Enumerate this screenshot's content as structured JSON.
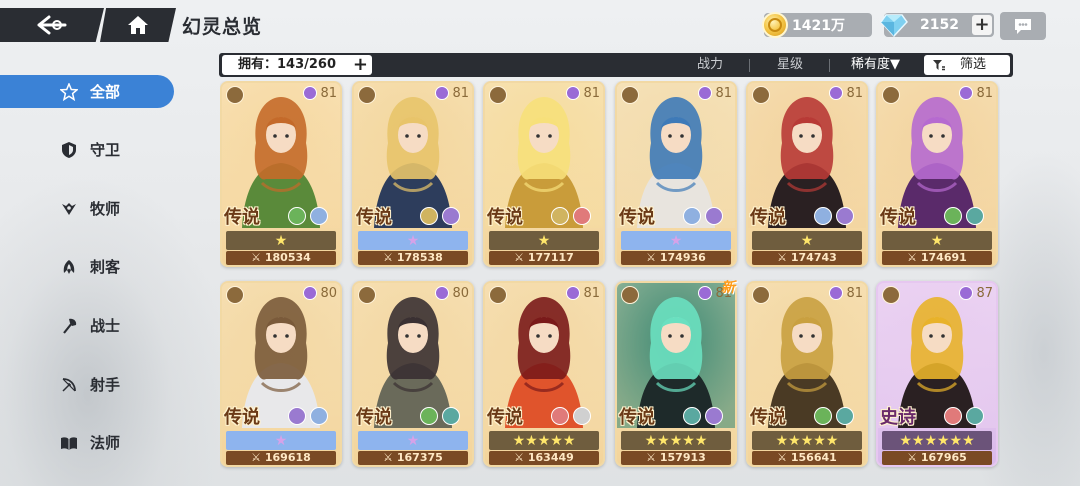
{
  "header": {
    "title": "幻灵总览",
    "gold": "1421万",
    "gems": "2152"
  },
  "filterbar": {
    "owned_label": "拥有：143/260",
    "sort_power": "战力",
    "sort_star": "星级",
    "sort_rarity": "稀有度▼",
    "filter_label": "筛选"
  },
  "sidebar": {
    "items": [
      {
        "label": "全部",
        "icon": "star-outline-icon",
        "active": true
      },
      {
        "label": "守卫",
        "icon": "shield-icon",
        "active": false
      },
      {
        "label": "牧师",
        "icon": "wings-icon",
        "active": false
      },
      {
        "label": "刺客",
        "icon": "dagger-icon",
        "active": false
      },
      {
        "label": "战士",
        "icon": "axe-icon",
        "active": false
      },
      {
        "label": "射手",
        "icon": "bow-icon",
        "active": false
      },
      {
        "label": "法师",
        "icon": "book-icon",
        "active": false
      }
    ]
  },
  "cards": [
    {
      "rarity": "传说",
      "level": "81",
      "power": "180534",
      "band": "dark",
      "stars": "★",
      "palette": [
        "#f6d9a3",
        "#5a8a3a",
        "#c46a2a"
      ],
      "elements": [
        "#6bb35a",
        "#8fb0e0"
      ],
      "role": "book-icon"
    },
    {
      "rarity": "传说",
      "level": "81",
      "power": "178538",
      "band": "blue",
      "stars": "★",
      "palette": [
        "#f3d79f",
        "#2d3d5c",
        "#e8c46a"
      ],
      "elements": [
        "#d0b460",
        "#9a7ad0"
      ],
      "role": "axe-icon"
    },
    {
      "rarity": "传说",
      "level": "81",
      "power": "177117",
      "band": "dark",
      "stars": "★",
      "palette": [
        "#f5dca0",
        "#c99c3a",
        "#f7e07a"
      ],
      "elements": [
        "#d0b460",
        "#e07a7a"
      ],
      "role": "bow-icon"
    },
    {
      "rarity": "传说",
      "level": "81",
      "power": "174936",
      "band": "blue",
      "stars": "★",
      "palette": [
        "#f2dcae",
        "#e8e4de",
        "#3e7ab8"
      ],
      "elements": [
        "#8fb0e0",
        "#9a7ad0"
      ],
      "role": "shield-icon"
    },
    {
      "rarity": "传说",
      "level": "81",
      "power": "174743",
      "band": "dark",
      "stars": "★",
      "palette": [
        "#f2d4a0",
        "#2a2022",
        "#b83a36"
      ],
      "elements": [
        "#8fb0e0",
        "#9a7ad0"
      ],
      "role": "bow-icon"
    },
    {
      "rarity": "传说",
      "level": "81",
      "power": "174691",
      "band": "dark",
      "stars": "★",
      "palette": [
        "#f2d4a0",
        "#5a2a6a",
        "#b66ad0"
      ],
      "elements": [
        "#6bb35a",
        "#5aa8a0"
      ],
      "role": "bow-icon"
    },
    {
      "rarity": "传说",
      "level": "80",
      "power": "169618",
      "band": "blue",
      "stars": "★",
      "palette": [
        "#f3d8a4",
        "#e8e8ea",
        "#7a5a3a"
      ],
      "elements": [
        "#9a7ad0",
        "#8fb0e0"
      ],
      "role": "wings-icon"
    },
    {
      "rarity": "传说",
      "level": "80",
      "power": "167375",
      "band": "blue",
      "stars": "★",
      "palette": [
        "#f3d8a4",
        "#6a6a5a",
        "#3a3032"
      ],
      "elements": [
        "#6bb35a",
        "#5aa8a0"
      ],
      "role": "wings-icon"
    },
    {
      "rarity": "传说",
      "level": "81",
      "power": "163449",
      "band": "dark",
      "stars": "★★★★★",
      "palette": [
        "#f3d8a4",
        "#e0542c",
        "#7a1a1a"
      ],
      "elements": [
        "#e07a7a",
        "#d0d0d0"
      ],
      "role": "wings-icon"
    },
    {
      "rarity": "传说",
      "level": "81",
      "power": "157913",
      "band": "dark",
      "stars": "★★★★★",
      "palette": [
        "#3e8a74",
        "#1e2a2a",
        "#6ae0c0"
      ],
      "elements": [
        "#5aa8a0",
        "#9a7ad0"
      ],
      "role": "axe-icon",
      "is_new": true,
      "new_label": "新"
    },
    {
      "rarity": "传说",
      "level": "81",
      "power": "156641",
      "band": "dark",
      "stars": "★★★★★",
      "palette": [
        "#f3d8a4",
        "#4a3a24",
        "#c9a040"
      ],
      "elements": [
        "#6bb35a",
        "#5aa8a0"
      ],
      "role": "axe-icon"
    },
    {
      "rarity": "史诗",
      "level": "87",
      "power": "167965",
      "band": "purple",
      "stars": "★★★★★★",
      "palette": [
        "#e8cdf0",
        "#2a2022",
        "#e8b22a"
      ],
      "elements": [
        "#e07a7a",
        "#5aa8a0"
      ],
      "role": "dagger-icon",
      "epic": true
    }
  ]
}
